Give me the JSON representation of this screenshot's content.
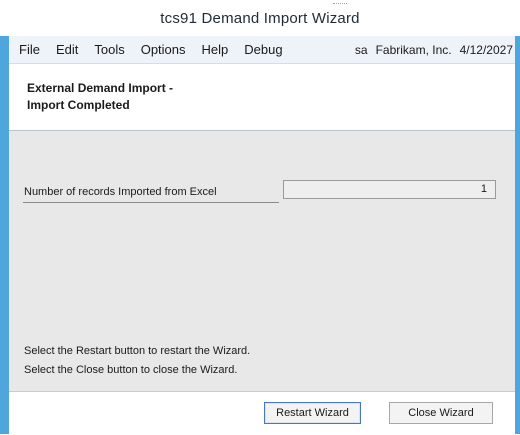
{
  "window": {
    "title": "tcs91 Demand Import Wizard"
  },
  "menu": {
    "items": [
      "File",
      "Edit",
      "Tools",
      "Options",
      "Help",
      "Debug"
    ],
    "user": "sa",
    "company": "Fabrikam, Inc.",
    "date": "4/12/2027"
  },
  "header": {
    "line1": "External Demand Import -",
    "line2": "Import Completed"
  },
  "form": {
    "records_label": "Number of records Imported from Excel",
    "records_value": "1"
  },
  "instructions": {
    "line1": "Select the Restart button to restart the Wizard.",
    "line2": "Select the Close button to close the Wizard."
  },
  "buttons": {
    "restart_label": "Restart Wizard",
    "close_label": "Close Wizard"
  }
}
